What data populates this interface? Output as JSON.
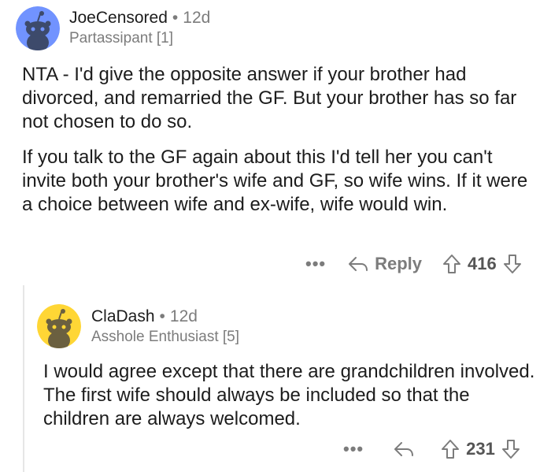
{
  "comments": [
    {
      "author": "JoeCensored",
      "separator": "•",
      "age": "12d",
      "flair": "Partassipant [1]",
      "paragraphs": [
        "NTA - I'd give the opposite answer if your brother had divorced, and remarried the GF.  But your brother has so far not chosen to do so.",
        "If you talk to the GF again about this I'd tell her you can't invite both your brother's wife and GF, so wife wins.  If it were a choice between wife and ex-wife, wife would win."
      ],
      "more_label": "•••",
      "reply_label": "Reply",
      "score": "416",
      "avatar_color": "#7193ff"
    },
    {
      "author": "ClaDash",
      "separator": "•",
      "age": "12d",
      "flair": "Asshole Enthusiast [5]",
      "paragraphs": [
        "I would agree except that there are grandchildren involved. The first wife should always be included so that the children are always welcomed."
      ],
      "more_label": "•••",
      "score": "231",
      "avatar_color": "#ffd635"
    }
  ]
}
